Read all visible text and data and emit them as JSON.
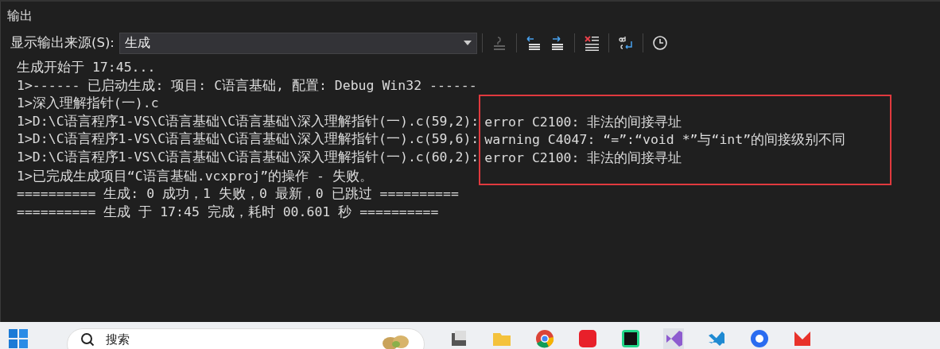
{
  "window": {
    "title": "输出"
  },
  "toolbar": {
    "source_label": "显示输出来源(S):",
    "source_value": "生成",
    "buttons": [
      {
        "kind": "find",
        "disabled": true
      },
      {
        "kind": "prev",
        "disabled": false
      },
      {
        "kind": "next",
        "disabled": false
      },
      {
        "kind": "clear",
        "disabled": false
      },
      {
        "kind": "wrap",
        "disabled": false
      },
      {
        "kind": "clock",
        "disabled": false
      }
    ]
  },
  "output": {
    "lines_before": [
      "生成开始于 17:45...",
      "1>------ 已启动生成: 项目: C语言基础, 配置: Debug Win32 ------",
      "1>深入理解指针(一).c"
    ],
    "diagnostics": [
      {
        "location": "1>D:\\C语言程序1-VS\\C语言基础\\C语言基础\\深入理解指针(一).c(59,2):",
        "message": "error C2100: 非法的间接寻址"
      },
      {
        "location": "1>D:\\C语言程序1-VS\\C语言基础\\C语言基础\\深入理解指针(一).c(59,6):",
        "message": "warning C4047: “=”:“void *”与“int”的间接级别不同"
      },
      {
        "location": "1>D:\\C语言程序1-VS\\C语言基础\\C语言基础\\深入理解指针(一).c(60,2):",
        "message": "error C2100: 非法的间接寻址"
      }
    ],
    "lines_after": [
      "1>已完成生成项目“C语言基础.vcxproj”的操作 - 失败。",
      "========== 生成: 0 成功，1 失败，0 最新，0 已跳过 ==========",
      "========== 生成 于 17:45 完成，耗时 00.601 秒 =========="
    ]
  },
  "taskbar": {
    "search_placeholder": "搜索"
  }
}
